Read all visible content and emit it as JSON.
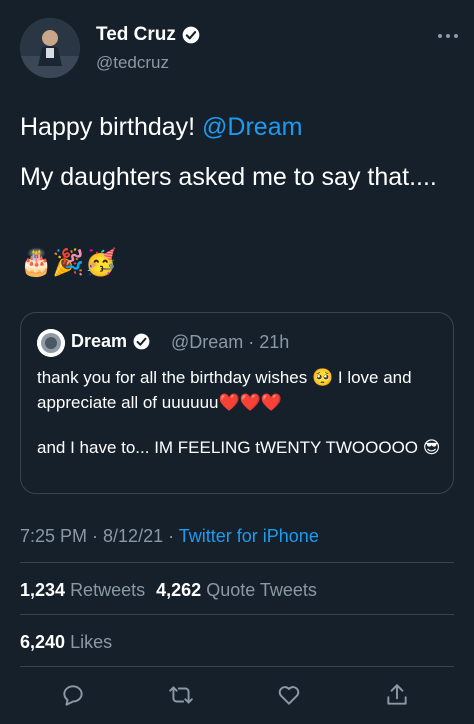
{
  "tweet": {
    "author_name": "Ted Cruz",
    "author_handle": "@tedcruz",
    "line1_prefix": "Happy birthday! ",
    "line1_mention": "@Dream",
    "line2": "My daughters asked me to say that....",
    "emojis": "🎂🎉🥳",
    "timestamp": "7:25 PM · 8/12/21 · ",
    "source": "Twitter for iPhone"
  },
  "quote": {
    "author_name": "Dream",
    "meta": "@Dream · 21h",
    "text1": "thank you for all the birthday wishes 🥺 I love and appreciate all of uuuuuu❤️❤️❤️",
    "text2": "and I have to... IM FEELING tWENTY TWOOOOO 😎"
  },
  "stats": {
    "retweets_count": "1,234",
    "retweets_label": "Retweets",
    "quotes_count": "4,262",
    "quotes_label": "Quote Tweets",
    "likes_count": "6,240",
    "likes_label": "Likes"
  },
  "colors": {
    "background": "#15202b",
    "link": "#1d9bf0",
    "secondary_text": "#8b98a5",
    "border": "#38444d"
  },
  "icons": [
    "verified-icon",
    "more-icon",
    "reply-icon",
    "retweet-icon",
    "like-icon",
    "share-icon"
  ]
}
